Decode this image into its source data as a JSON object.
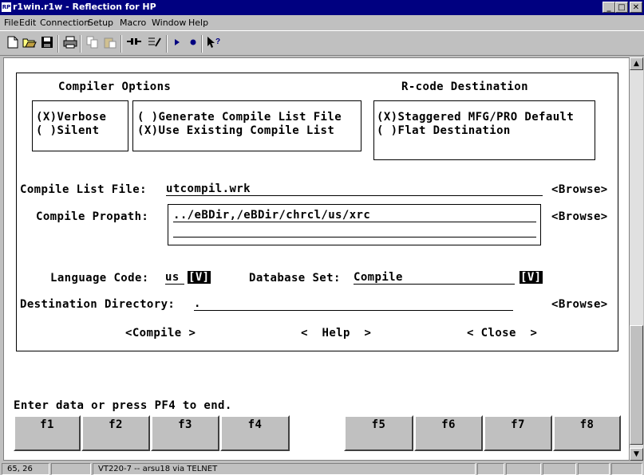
{
  "window": {
    "title": "r1win.r1w - Reflection for HP",
    "app_icon": "RP",
    "caption_buttons": [
      "_",
      "□",
      "✕"
    ]
  },
  "menubar": {
    "items": [
      "File",
      "Edit",
      "Connection",
      "Setup",
      "Macro",
      "Window",
      "Help"
    ]
  },
  "toolbar": {
    "icons": [
      "new-icon",
      "open-icon",
      "save-icon",
      "print-icon",
      "copy-icon",
      "paste-icon",
      "connect-icon",
      "transfer-icon",
      "play-macro-icon",
      "record-macro-icon",
      "context-help-icon"
    ]
  },
  "screen": {
    "compiler_options_title": "Compiler Options",
    "rcode_title": "R-code Destination",
    "verbose": "(X)Verbose",
    "silent": "( )Silent",
    "gen_compile_list": "( )Generate Compile List File",
    "use_compile_list": "(X)Use Existing Compile List",
    "staggered": "(X)Staggered MFG/PRO Default",
    "flat_dest": "( )Flat Destination",
    "compile_list_label": "Compile List File:",
    "compile_list_value": "utcompil.wrk",
    "browse1": "<Browse>",
    "propath_label": "Compile Propath:",
    "propath_value": "../eBDir,/eBDir/chrcl/us/xrc",
    "browse2": "<Browse>",
    "language_label": "Language Code:",
    "language_value": "us",
    "language_btn": "[V]",
    "dbset_label": "Database Set:",
    "dbset_value": "Compile",
    "dbset_btn": "[V]",
    "dest_label": "Destination Directory:",
    "dest_value": ".",
    "browse3": "<Browse>",
    "compile_btn": "<Compile >",
    "help_btn": "<  Help  >",
    "close_btn": "< Close  >",
    "status_msg": "Enter data or press PF4 to end."
  },
  "function_keys": [
    "f1",
    "f2",
    "f3",
    "f4",
    "f5",
    "f6",
    "f7",
    "f8"
  ],
  "statusbar": {
    "cursor": "65, 26",
    "connection": "VT220-7 -- arsu18 via TELNET"
  },
  "colors": {
    "title_bar": "#000080",
    "window_face": "#c0c0c0",
    "terminal_bg": "#ffffff"
  }
}
